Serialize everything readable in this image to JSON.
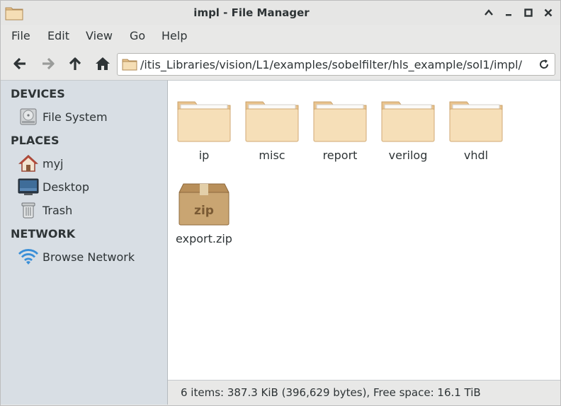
{
  "window": {
    "title": "impl - File Manager",
    "controls": {
      "minimize": "⌃",
      "restore": "–",
      "maximize": "□",
      "close": "✕"
    }
  },
  "menubar": {
    "items": [
      "File",
      "Edit",
      "View",
      "Go",
      "Help"
    ]
  },
  "toolbar": {
    "path": "/itis_Libraries/vision/L1/examples/sobelfilter/hls_example/sol1/impl/"
  },
  "sidebar": {
    "sections": [
      {
        "heading": "DEVICES",
        "items": [
          {
            "label": "File System",
            "icon": "drive-icon"
          }
        ]
      },
      {
        "heading": "PLACES",
        "items": [
          {
            "label": "myj",
            "icon": "home-icon"
          },
          {
            "label": "Desktop",
            "icon": "desktop-icon"
          },
          {
            "label": "Trash",
            "icon": "trash-icon"
          }
        ]
      },
      {
        "heading": "NETWORK",
        "items": [
          {
            "label": "Browse Network",
            "icon": "wifi-icon"
          }
        ]
      }
    ]
  },
  "files": [
    {
      "name": "ip",
      "type": "folder"
    },
    {
      "name": "misc",
      "type": "folder"
    },
    {
      "name": "report",
      "type": "folder"
    },
    {
      "name": "verilog",
      "type": "folder"
    },
    {
      "name": "vhdl",
      "type": "folder"
    },
    {
      "name": "export.zip",
      "type": "zip",
      "badge": "zip"
    }
  ],
  "status": "6 items: 387.3 KiB (396,629 bytes), Free space: 16.1 TiB",
  "colors": {
    "sidebar_bg": "#d8dee4",
    "folder_light": "#f6dfb8",
    "folder_dark": "#e9c48f",
    "box": "#c9a572"
  }
}
